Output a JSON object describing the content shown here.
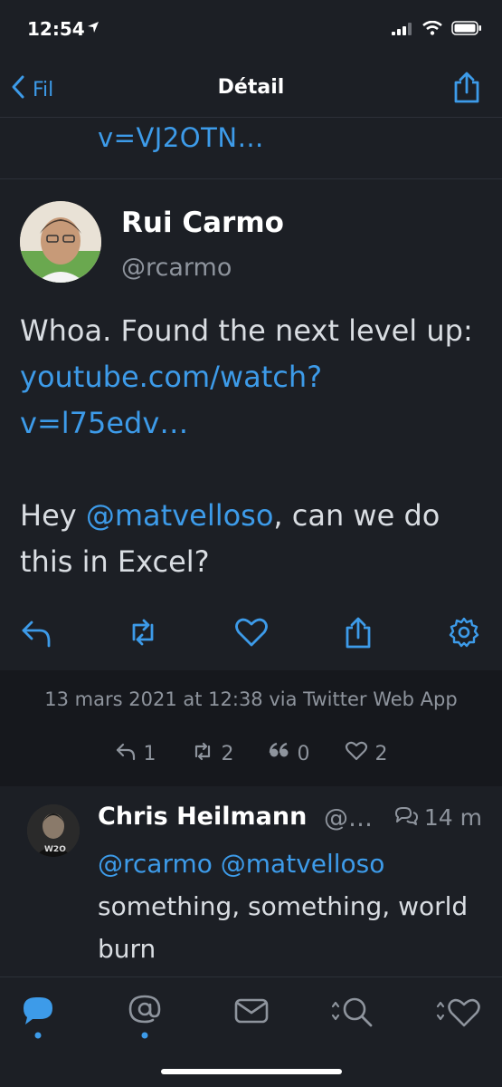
{
  "status_bar": {
    "time": "12:54"
  },
  "nav": {
    "back_label": "Fil",
    "title": "Détail"
  },
  "previous_tweet": {
    "link_fragment": "v=VJ2OTN…"
  },
  "tweet": {
    "author_name": "Rui Carmo",
    "author_handle": "@rcarmo",
    "text_part1": "Whoa. Found the next level up: ",
    "link_text": "youtube.com/watch?v=l75edv…",
    "text_part2": "Hey ",
    "mention": "@matvelloso",
    "text_part3": ", can we do this in Excel?",
    "timestamp": "13 mars 2021 at 12:38 via Twitter Web App",
    "counts": {
      "replies": "1",
      "retweets": "2",
      "quotes": "0",
      "likes": "2"
    }
  },
  "reply": {
    "author_name": "Chris Heilmann",
    "author_handle": "@…",
    "time": "14 m",
    "mention1": "@rcarmo",
    "mention2": "@matvelloso",
    "text": "something, something, world burn"
  },
  "colors": {
    "accent": "#3d9be9",
    "background": "#1c1f25",
    "secondary_text": "#8e949d"
  },
  "icons": {
    "nav": [
      "chevron-left-icon",
      "share-icon"
    ],
    "actions": [
      "reply-icon",
      "retweet-icon",
      "like-icon",
      "share-icon",
      "gear-icon"
    ],
    "tabs": [
      "timeline-bubble-icon",
      "mentions-icon",
      "messages-icon",
      "search-icon",
      "likes-icon"
    ]
  }
}
